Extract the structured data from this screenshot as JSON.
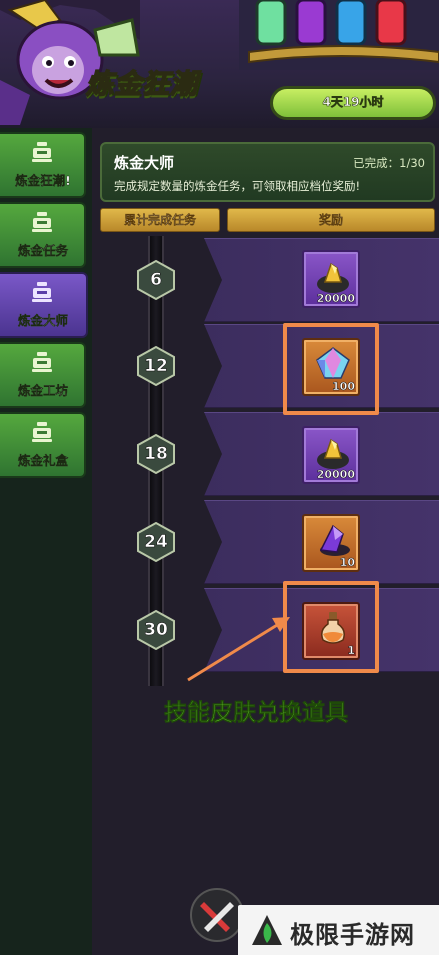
{
  "header": {
    "event_title": "炼金狂潮",
    "countdown": "4天19小时"
  },
  "sidebar": {
    "tabs": [
      {
        "label": "炼金狂潮!",
        "active": false
      },
      {
        "label": "炼金任务",
        "active": false
      },
      {
        "label": "炼金大师",
        "active": true
      },
      {
        "label": "炼金工坊",
        "active": false
      },
      {
        "label": "炼金礼盒",
        "active": false
      }
    ]
  },
  "panel": {
    "title": "炼金大师",
    "progress": "已完成：1/30",
    "description": "完成规定数量的炼金任务，可领取相应档位奖励!",
    "col_tasks": "累计完成任务",
    "col_rewards": "奖励"
  },
  "milestones": [
    {
      "tasks": "6",
      "reward_qty": "20000",
      "reward_icon": "gold-ore-icon",
      "frame": "purple"
    },
    {
      "tasks": "12",
      "reward_qty": "100",
      "reward_icon": "rainbow-gem-icon",
      "frame": "orange"
    },
    {
      "tasks": "18",
      "reward_qty": "20000",
      "reward_icon": "gold-ore-icon",
      "frame": "purple"
    },
    {
      "tasks": "24",
      "reward_qty": "10",
      "reward_icon": "purple-crystal-icon",
      "frame": "orange"
    },
    {
      "tasks": "30",
      "reward_qty": "1",
      "reward_icon": "potion-flask-icon",
      "frame": "red"
    }
  ],
  "annotation": {
    "callout": "技能皮肤兑换道具"
  },
  "watermark": {
    "text": "极限手游网"
  },
  "colors": {
    "tab_green": "#3f8e37",
    "tab_active": "#5c41a8",
    "row_purple": "#40306a",
    "highlight": "#f08a4a",
    "callout_green": "#6fdc2e",
    "column_gold": "#c99a34"
  }
}
